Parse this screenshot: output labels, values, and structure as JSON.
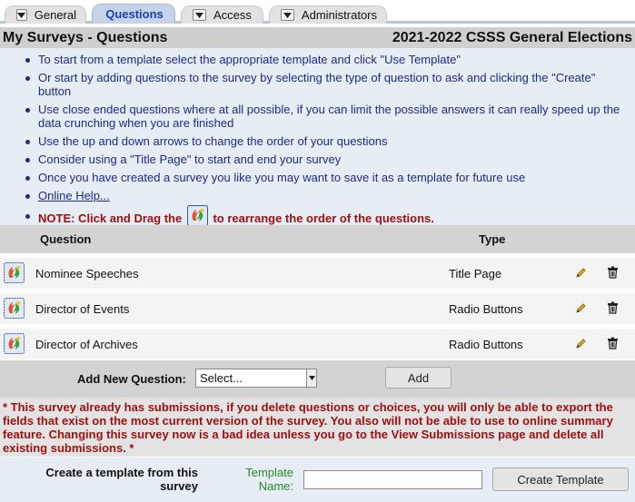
{
  "tabs": [
    {
      "label": "General",
      "active": false,
      "has_dropdown": true
    },
    {
      "label": "Questions",
      "active": true,
      "has_dropdown": false
    },
    {
      "label": "Access",
      "active": false,
      "has_dropdown": true
    },
    {
      "label": "Administrators",
      "active": false,
      "has_dropdown": true
    }
  ],
  "header": {
    "title": "My Surveys - Questions",
    "survey_name": "2021-2022 CSSS General Elections"
  },
  "instructions": {
    "items": [
      "To start from a template select the appropriate template and click \"Use Template\"",
      "Or start by adding questions to the survey by selecting the type of question to ask and clicking the \"Create\" button",
      "Use close ended questions where at all possible, if you can limit the possible answers it can really speed up the data crunching when you are finished",
      "Use the up and down arrows to change the order of your questions",
      "Consider using a \"Title Page\" to start and end your survey",
      "Once you have created a survey you like you may want to save it as a template for future use"
    ],
    "help_link": "Online Help...",
    "note_prefix": "NOTE: Click and Drag the",
    "note_suffix": "to rearrange the order of the questions."
  },
  "table": {
    "col_question": "Question",
    "col_type": "Type",
    "rows": [
      {
        "question": "Nominee Speeches",
        "type": "Title Page"
      },
      {
        "question": "Director of Events",
        "type": "Radio Buttons"
      },
      {
        "question": "Director of Archives",
        "type": "Radio Buttons"
      }
    ]
  },
  "add_question": {
    "label": "Add New Question:",
    "select_value": "Select...",
    "button": "Add"
  },
  "warning": "* This survey already has submissions, if you delete questions or choices, you will only be able to export the fields that exist on the most current version of the survey. You also will not be able to use to online summary feature. Changing this survey now is a bad idea unless you go to the View Submissions page and delete all existing submissions. *",
  "template": {
    "create_label": "Create a template from this survey",
    "name_label": "Template Name:",
    "name_value": "",
    "button": "Create Template"
  },
  "colors": {
    "active_tab_text": "#1a43a8",
    "instruction_text": "#1d2a8a",
    "warning_text": "#a01010",
    "template_name_label": "#2a8a2a",
    "instructions_bg": "#e6edf5"
  },
  "icons": {
    "drag": "drag-handle-icon",
    "edit": "pencil-icon",
    "delete": "trash-icon",
    "dropdown": "chevron-down-icon"
  }
}
